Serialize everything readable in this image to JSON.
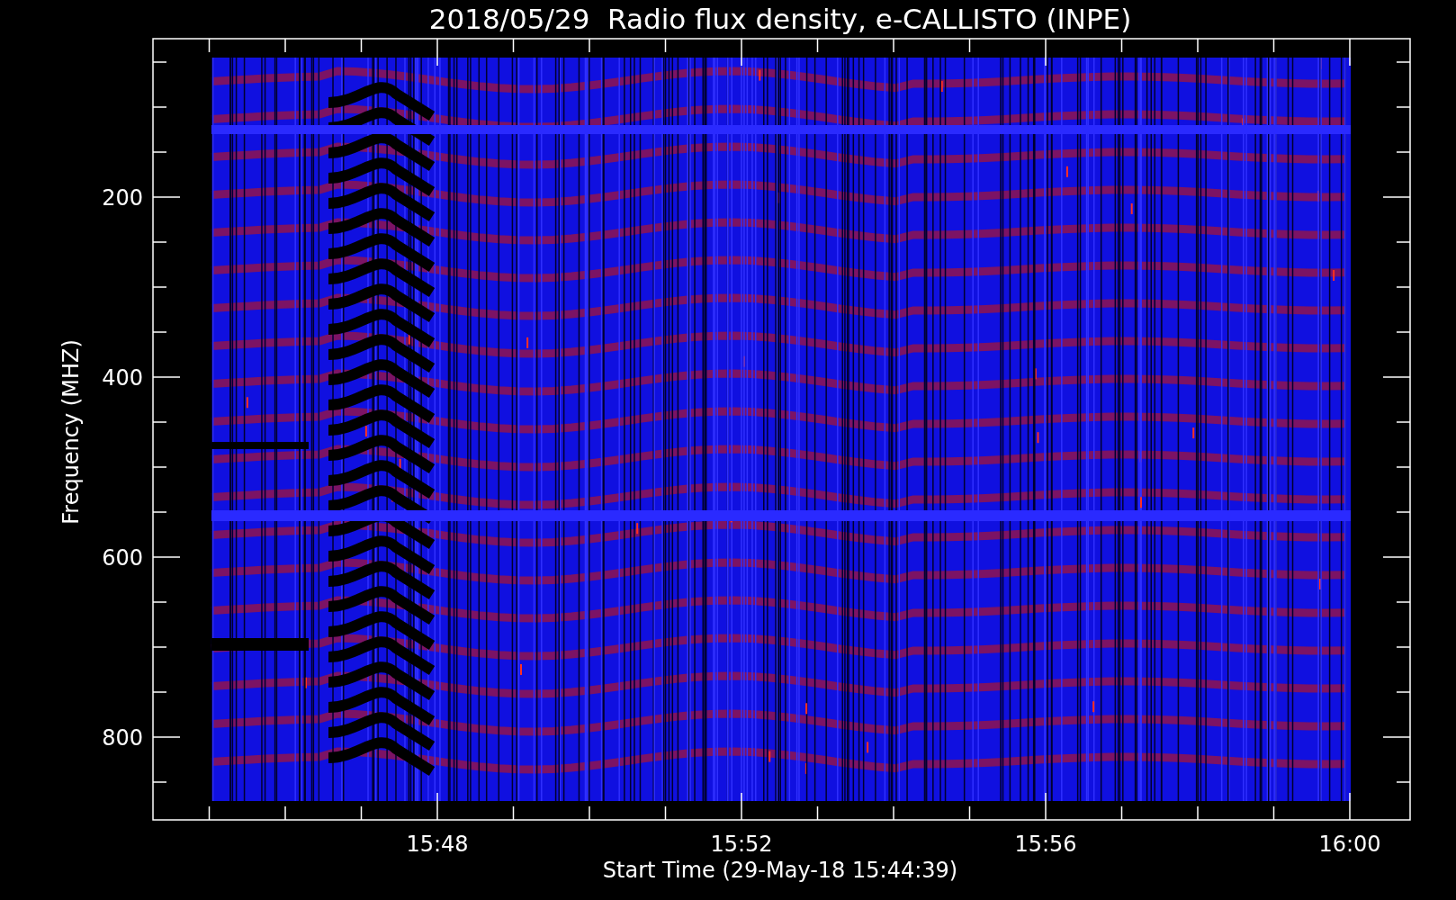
{
  "title": "2018/05/29  Radio flux density, e-CALLISTO (INPE)",
  "y_axis": {
    "label": "Frequency (MHZ)",
    "ticks": [
      "200",
      "400",
      "600",
      "800"
    ]
  },
  "x_axis": {
    "label": "Start Time (29-May-18 15:44:39)",
    "ticks": [
      "15:48",
      "15:52",
      "15:56",
      "16:00"
    ]
  }
}
